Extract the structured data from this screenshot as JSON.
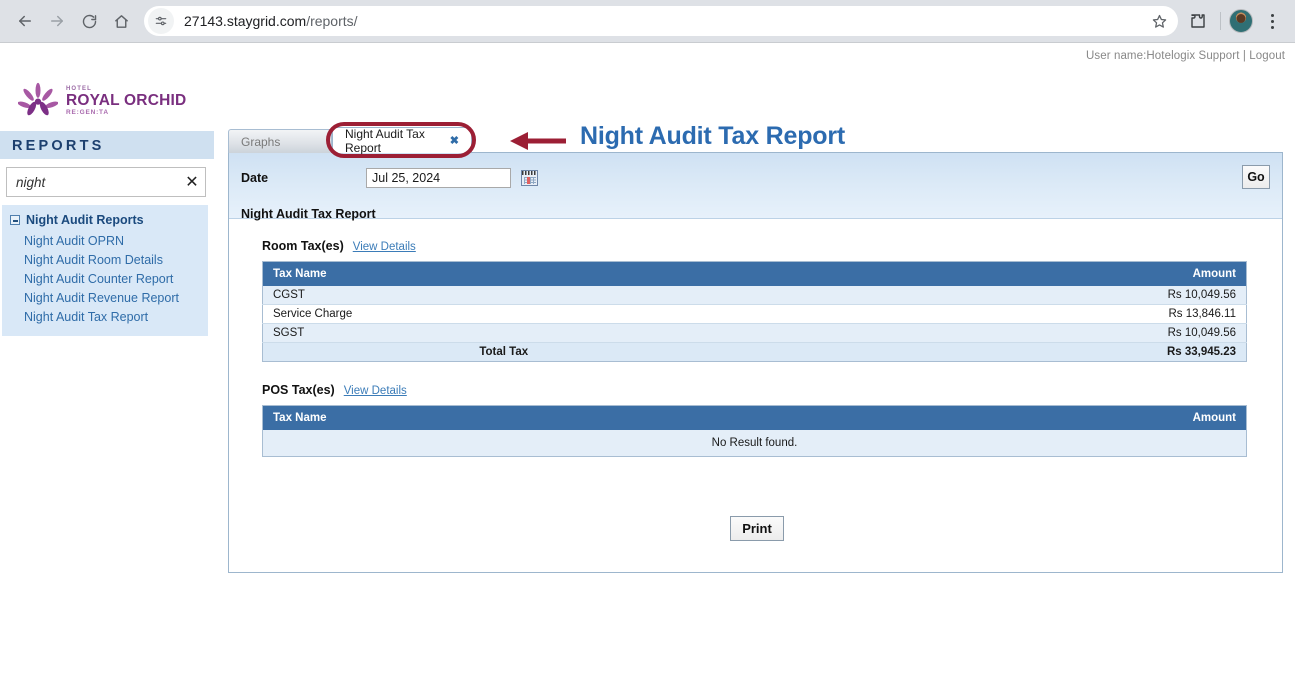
{
  "browser": {
    "url_host": "27143.staygrid.com",
    "url_path": "/reports/",
    "icons": {
      "back": "back-arrow-icon",
      "forward": "forward-arrow-icon",
      "reload": "reload-icon",
      "home": "home-icon",
      "site_info": "site-settings-icon",
      "bookmark": "star-icon",
      "extensions": "extensions-puzzle-icon",
      "profile": "profile-avatar",
      "menu": "chrome-menu-icon"
    }
  },
  "topbar": {
    "user_label": "User name:Hotelogix Support",
    "separator": "|",
    "logout_label": "Logout"
  },
  "sidebar": {
    "logo": {
      "top": "HOTEL",
      "main": "ROYAL ORCHID",
      "sub": "RE:GEN:TA"
    },
    "heading": "REPORTS",
    "search": {
      "value": "night",
      "placeholder": "Search",
      "clear_glyph": "✕"
    },
    "tree": {
      "group_label": "Night Audit Reports",
      "items": [
        {
          "label": "Night Audit OPRN"
        },
        {
          "label": "Night Audit Room Details"
        },
        {
          "label": "Night Audit Counter Report"
        },
        {
          "label": "Night Audit Revenue Report"
        },
        {
          "label": "Night Audit Tax Report"
        }
      ]
    }
  },
  "main": {
    "page_title": "Night Audit Tax Report",
    "tabs": [
      {
        "label": "Graphs",
        "active": false
      },
      {
        "label": "Night Audit Tax Report",
        "active": true,
        "close_glyph": "✖"
      }
    ],
    "filter": {
      "date_label": "Date",
      "date_value": "Jul 25, 2024",
      "date_placeholder": "Select date",
      "calendar_icon": "calendar-icon",
      "go_label": "Go"
    },
    "report_subtitle": "Night Audit Tax Report",
    "room_tax": {
      "section_label": "Room Tax(es)",
      "view_details_label": "View Details",
      "columns": [
        "Tax Name",
        "Amount"
      ],
      "rows": [
        {
          "name": "CGST",
          "amount": "Rs 10,049.56"
        },
        {
          "name": "Service Charge",
          "amount": "Rs 13,846.11"
        },
        {
          "name": "SGST",
          "amount": "Rs 10,049.56"
        }
      ],
      "total_label": "Total Tax",
      "total_amount": "Rs 33,945.23"
    },
    "pos_tax": {
      "section_label": "POS Tax(es)",
      "view_details_label": "View Details",
      "columns": [
        "Tax Name",
        "Amount"
      ],
      "empty_message": "No Result found."
    },
    "print_label": "Print"
  },
  "annotations": {
    "highlight_color": "#9c1f35",
    "oval_target": "Night Audit Tax Report tab",
    "arrow_glyph": "left-arrow-annotation"
  }
}
